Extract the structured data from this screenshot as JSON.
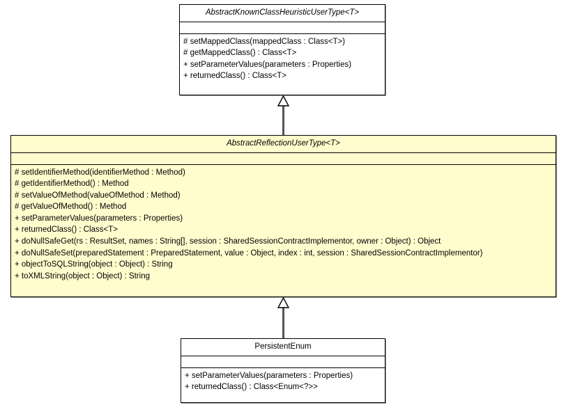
{
  "diagram": {
    "kind": "uml-class-diagram",
    "background_color": "#ffffff",
    "line_color": "#555555",
    "border_color": "#000000",
    "highlight_fill": "#fffdcd",
    "plain_fill": "#ffffff"
  },
  "classes": [
    {
      "id": "abstract-known-class-heuristic-user-type",
      "name": "AbstractKnownClassHeuristicUserType<T>",
      "abstract": true,
      "highlighted": false,
      "attributes": [],
      "operations": [
        "# setMappedClass(mappedClass : Class<T>)",
        "# getMappedClass() : Class<T>",
        "+ setParameterValues(parameters : Properties)",
        "+ returnedClass() : Class<T>"
      ]
    },
    {
      "id": "abstract-reflection-user-type",
      "name": "AbstractReflectionUserType<T>",
      "abstract": true,
      "highlighted": true,
      "attributes": [],
      "operations": [
        "# setIdentifierMethod(identifierMethod : Method)",
        "# getIdentifierMethod() : Method",
        "# setValueOfMethod(valueOfMethod : Method)",
        "# getValueOfMethod() : Method",
        "+ setParameterValues(parameters : Properties)",
        "+ returnedClass() : Class<T>",
        "+ doNullSafeGet(rs : ResultSet, names : String[], session : SharedSessionContractImplementor, owner : Object) : Object",
        "+ doNullSafeSet(preparedStatement : PreparedStatement, value : Object, index : int, session : SharedSessionContractImplementor)",
        "+ objectToSQLString(object : Object) : String",
        "+ toXMLString(object : Object) : String"
      ]
    },
    {
      "id": "persistent-enum",
      "name": "PersistentEnum",
      "abstract": false,
      "highlighted": false,
      "attributes": [],
      "operations": [
        "+ setParameterValues(parameters : Properties)",
        "+ returnedClass() : Class<Enum<?>>"
      ]
    }
  ],
  "relationships": [
    {
      "id": "gen-middle-to-top",
      "type": "generalization",
      "from": "abstract-reflection-user-type",
      "to": "abstract-known-class-heuristic-user-type"
    },
    {
      "id": "gen-bottom-to-middle",
      "type": "generalization",
      "from": "persistent-enum",
      "to": "abstract-reflection-user-type"
    }
  ]
}
